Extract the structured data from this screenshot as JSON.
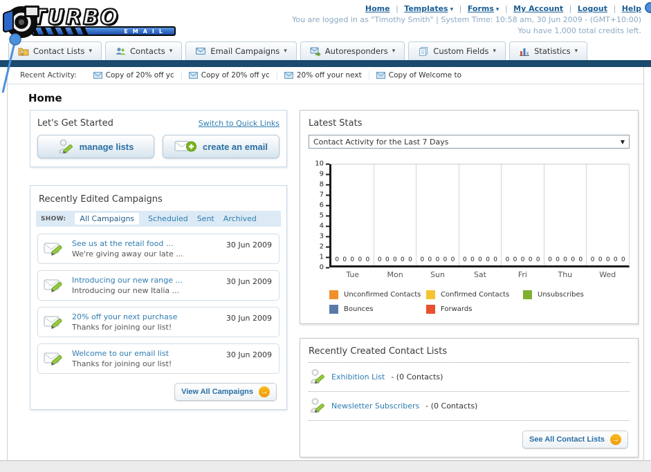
{
  "header": {
    "logo": {
      "title": "TURBO",
      "subtitle": "EMAIL"
    },
    "nav_links": [
      {
        "label": "Home"
      },
      {
        "label": "Templates",
        "dropdown": true
      },
      {
        "label": "Forms",
        "dropdown": true
      },
      {
        "label": "My Account"
      },
      {
        "label": "Logout"
      },
      {
        "label": "Help"
      }
    ],
    "login_info": "You are logged in as \"Timothy Smith\" | System Time: 10:58 am, 30 Jun 2009 - (GMT+10:00)",
    "credits_info": "You have 1,000 total credits left."
  },
  "tabs": [
    {
      "label": "Contact Lists",
      "icon": "contact-lists-folder-icon"
    },
    {
      "label": "Contacts",
      "icon": "contacts-people-icon"
    },
    {
      "label": "Email Campaigns",
      "icon": "envelope-icon"
    },
    {
      "label": "Autoresponders",
      "icon": "envelope-arrow-icon"
    },
    {
      "label": "Custom Fields",
      "icon": "pages-icon"
    },
    {
      "label": "Statistics",
      "icon": "bar-chart-icon"
    }
  ],
  "recent_activity": {
    "label": "Recent Activity:",
    "items": [
      "Copy of 20% off yc",
      "Copy of 20% off yc",
      "20% off your next",
      "Copy of Welcome to"
    ]
  },
  "page_title": "Home",
  "get_started": {
    "title": "Let's Get Started",
    "switch_link": "Switch to Quick Links",
    "buttons": [
      {
        "label": "manage lists",
        "icon": "person-pencil-icon"
      },
      {
        "label": "create an email",
        "icon": "envelope-plus-icon"
      }
    ]
  },
  "campaigns": {
    "title": "Recently Edited Campaigns",
    "show_label": "SHOW:",
    "filters": [
      "All Campaigns",
      "Scheduled",
      "Sent",
      "Archived"
    ],
    "active_filter": "All Campaigns",
    "items": [
      {
        "title": "See us at the retail food ...",
        "subtitle": "We're giving away our late ...",
        "date": "30 Jun 2009"
      },
      {
        "title": "Introducing our new range ...",
        "subtitle": "Introducing our new Italia ...",
        "date": "30 Jun 2009"
      },
      {
        "title": "20% off your next purchase",
        "subtitle": "Thanks for joining our list!",
        "date": "30 Jun 2009"
      },
      {
        "title": "Welcome to our email list",
        "subtitle": "Thanks for joining our list!",
        "date": "30 Jun 2009"
      }
    ],
    "view_all_label": "View All Campaigns"
  },
  "stats": {
    "title": "Latest Stats",
    "dropdown_value": "Contact Activity for the Last 7 Days"
  },
  "chart_data": {
    "type": "bar",
    "categories": [
      "Tue",
      "Mon",
      "Sun",
      "Sat",
      "Fri",
      "Thu",
      "Wed"
    ],
    "series": [
      {
        "name": "Unconfirmed Contacts",
        "color": "#f0912c",
        "values": [
          0,
          0,
          0,
          0,
          0,
          0,
          0
        ]
      },
      {
        "name": "Confirmed Contacts",
        "color": "#f6c331",
        "values": [
          0,
          0,
          0,
          0,
          0,
          0,
          0
        ]
      },
      {
        "name": "Unsubscribes",
        "color": "#7fb032",
        "values": [
          0,
          0,
          0,
          0,
          0,
          0,
          0
        ]
      },
      {
        "name": "Bounces",
        "color": "#5a79ab",
        "values": [
          0,
          0,
          0,
          0,
          0,
          0,
          0
        ]
      },
      {
        "name": "Forwards",
        "color": "#e8502e",
        "values": [
          0,
          0,
          0,
          0,
          0,
          0,
          0
        ]
      }
    ],
    "title": "Contact Activity for the Last 7 Days",
    "xlabel": "",
    "ylabel": "",
    "ylim": [
      0,
      10
    ],
    "yticks": [
      0,
      1,
      2,
      3,
      4,
      5,
      6,
      7,
      8,
      9,
      10
    ],
    "grid": true,
    "legend_position": "bottom",
    "data_labels_shown": true
  },
  "contact_lists": {
    "title": "Recently Created Contact Lists",
    "items": [
      {
        "name": "Exhibition List",
        "detail": "- (0 Contacts)"
      },
      {
        "name": "Newsletter Subscribers",
        "detail": "- (0 Contacts)"
      }
    ],
    "see_all_label": "See All Contact Lists"
  },
  "icons": {
    "caret_down": "▾",
    "select_arrow": "▼",
    "arrow_right": "→",
    "separator": "|"
  },
  "colors": {
    "accent_blue": "#2e7cb0",
    "navy_bar": "#1a4a6e",
    "orange_button": "#f0a10c",
    "annotation_pin": "#4a90dd"
  }
}
